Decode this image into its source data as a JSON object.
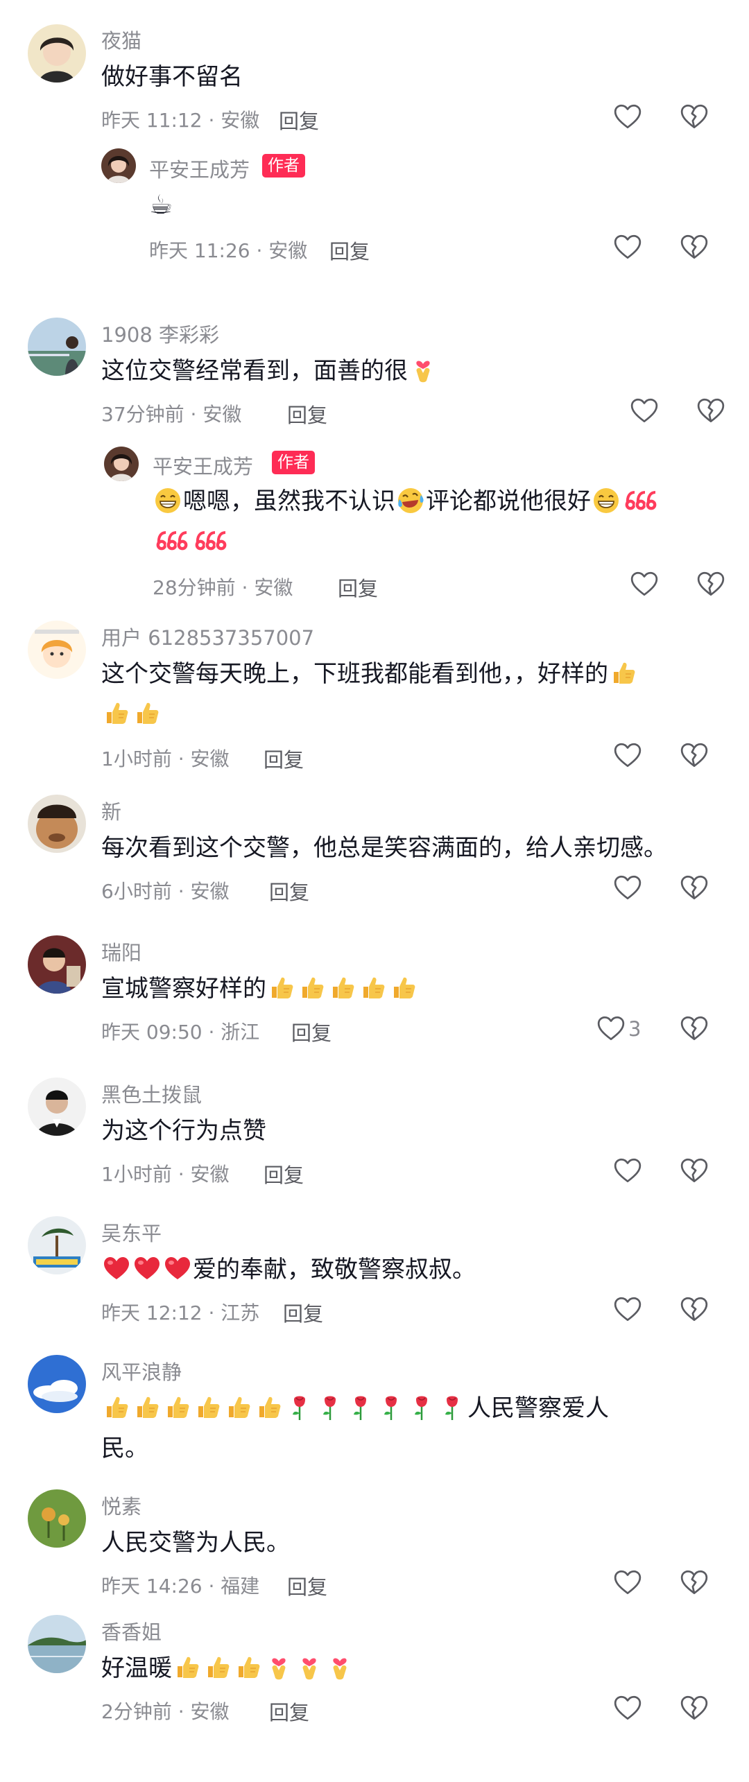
{
  "reply_label": "回复",
  "author_badge": "作者",
  "colors": {
    "name": "#8a8b91",
    "text": "#161823",
    "badge": "#fe2c55",
    "thumb": "#f7c64a"
  },
  "comments": [
    {
      "name": "夜猫",
      "text": "做好事不留名",
      "meta": "昨天 11:12 · 安徽"
    },
    {
      "name": "平安王成芳",
      "text": "☕",
      "meta": "昨天 11:26 · 安徽",
      "is_author": true
    },
    {
      "name": "1908 李彩彩",
      "text": "这位交警经常看到，面善的很",
      "meta": "37分钟前 · 安徽"
    },
    {
      "name": "平安王成芳",
      "text": "嗯嗯，虽然我不认识",
      "text2": "评论都说他很好",
      "text3": "666",
      "meta": "28分钟前 · 安徽",
      "is_author": true
    },
    {
      "name": "用户 6128537357007",
      "text": "这个交警每天晚上，下班我都能看到他，，好样的",
      "meta": "1小时前 · 安徽"
    },
    {
      "name": "新",
      "text": "每次看到这个交警，他总是笑容满面的，给人亲切感。",
      "meta": "6小时前 · 安徽"
    },
    {
      "name": "瑞阳",
      "text": "宣城警察好样的",
      "meta": "昨天 09:50 · 浙江",
      "likes": "3"
    },
    {
      "name": "黑色土拨鼠",
      "text": "为这个行为点赞",
      "meta": "1小时前 · 安徽"
    },
    {
      "name": "吴东平",
      "text": "爱的奉献，致敬警察叔叔。",
      "meta": "昨天 12:12 · 江苏"
    },
    {
      "name": "风平浪静",
      "text": "人民警察爱人",
      "text2": "民。"
    },
    {
      "name": "悦素",
      "text": "人民交警为人民。",
      "meta": "昨天 14:26 · 福建"
    },
    {
      "name": "香香姐",
      "text": "好温暖",
      "meta": "2分钟前 · 安徽"
    }
  ]
}
